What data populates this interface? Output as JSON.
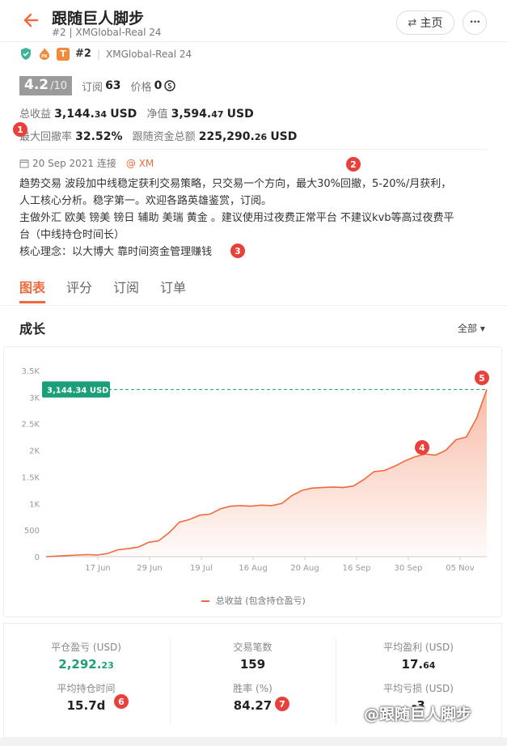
{
  "header": {
    "title": "跟随巨人脚步",
    "subtitle": "#2 | XMGlobal-Real 24",
    "home_label": "主页",
    "more_label": "•••"
  },
  "badges": {
    "t_label": "T",
    "rank": "#2",
    "sep": "|",
    "broker": "XMGlobal-Real 24"
  },
  "score": {
    "value": "4.2",
    "denominator": "/10",
    "subs_label": "订阅",
    "subs_value": "63",
    "price_label": "价格",
    "price_value": "0"
  },
  "stats_top": {
    "total_profit_label": "总收益",
    "total_profit_int": "3,144.",
    "total_profit_dec": "34",
    "total_profit_unit": "USD",
    "equity_label": "净值",
    "equity_int": "3,594.",
    "equity_dec": "47",
    "equity_unit": "USD",
    "drawdown_label": "最大回撤率",
    "drawdown_value": "32.52%",
    "follow_label": "跟随资金总额",
    "follow_int": "225,290.",
    "follow_dec": "26",
    "follow_unit": "USD"
  },
  "profile": {
    "date": "20 Sep 2021 连接",
    "broker_tag": "@ XM",
    "desc_line1": "趋势交易 波段加中线稳定获利交易策略，只交易一个方向，最大30%回撤，5-20%/月获利，",
    "desc_line2": "人工核心分析。稳字第一。欢迎各路英雄鉴赏，订阅。",
    "desc_line3": "主做外汇 欧美 镑美 镑日  辅助 美瑞 黄金 。建议使用过夜费正常平台 不建议kvb等高过夜费平",
    "desc_line4": "台（中线持仓时间长）",
    "desc_line5": "核心理念：以大博大 靠时间资金管理赚钱"
  },
  "tabs": [
    "图表",
    "评分",
    "订阅",
    "订单"
  ],
  "section": {
    "title": "成长",
    "filter": "全部 ▾"
  },
  "chart_data": {
    "type": "area",
    "title": "",
    "xlabel": "",
    "ylabel": "",
    "ylim": [
      0,
      3500
    ],
    "y_ticks": [
      "0",
      "500",
      "1K",
      "1.5K",
      "2K",
      "2.5K",
      "3K",
      "3.5K"
    ],
    "x_ticks": [
      "17 Jun",
      "29 Jun",
      "19 Jul",
      "16 Aug",
      "20 Aug",
      "16 Sep",
      "30 Sep",
      "05 Nov"
    ],
    "current_label": "3,144.34 USD",
    "current_value": 3144.34,
    "series": [
      {
        "name": "总收益 (包含持仓盈亏)",
        "values": [
          0,
          10,
          20,
          30,
          40,
          30,
          60,
          130,
          150,
          180,
          270,
          300,
          450,
          650,
          700,
          780,
          800,
          900,
          950,
          960,
          950,
          970,
          960,
          1000,
          1150,
          1250,
          1290,
          1300,
          1310,
          1300,
          1330,
          1450,
          1600,
          1620,
          1700,
          1800,
          1880,
          1930,
          1910,
          2000,
          2200,
          2250,
          2600,
          3144.34
        ]
      }
    ],
    "color": "#f06a3c",
    "grid": false,
    "legend_position": "bottom"
  },
  "bottom_stats": {
    "closed_pl_label": "平仓盈亏 (USD)",
    "closed_pl_int": "2,292.",
    "closed_pl_dec": "23",
    "trades_label": "交易笔数",
    "trades_value": "159",
    "avg_win_label": "平均盈利 (USD)",
    "avg_win_int": "17.",
    "avg_win_dec": "64",
    "avg_hold_label": "平均持仓时间",
    "avg_hold_value": "15.7d",
    "win_rate_label": "胜率 (%)",
    "win_rate_value": "84.27",
    "avg_loss_label": "平均亏损 (USD)",
    "avg_loss_value": "-3"
  },
  "markers": [
    "1",
    "2",
    "3",
    "4",
    "5",
    "6",
    "7"
  ],
  "watermark": "@跟随巨人脚步",
  "colors": {
    "accent": "#f06a3c",
    "green": "#1a9f7a",
    "marker": "#e8403a"
  }
}
